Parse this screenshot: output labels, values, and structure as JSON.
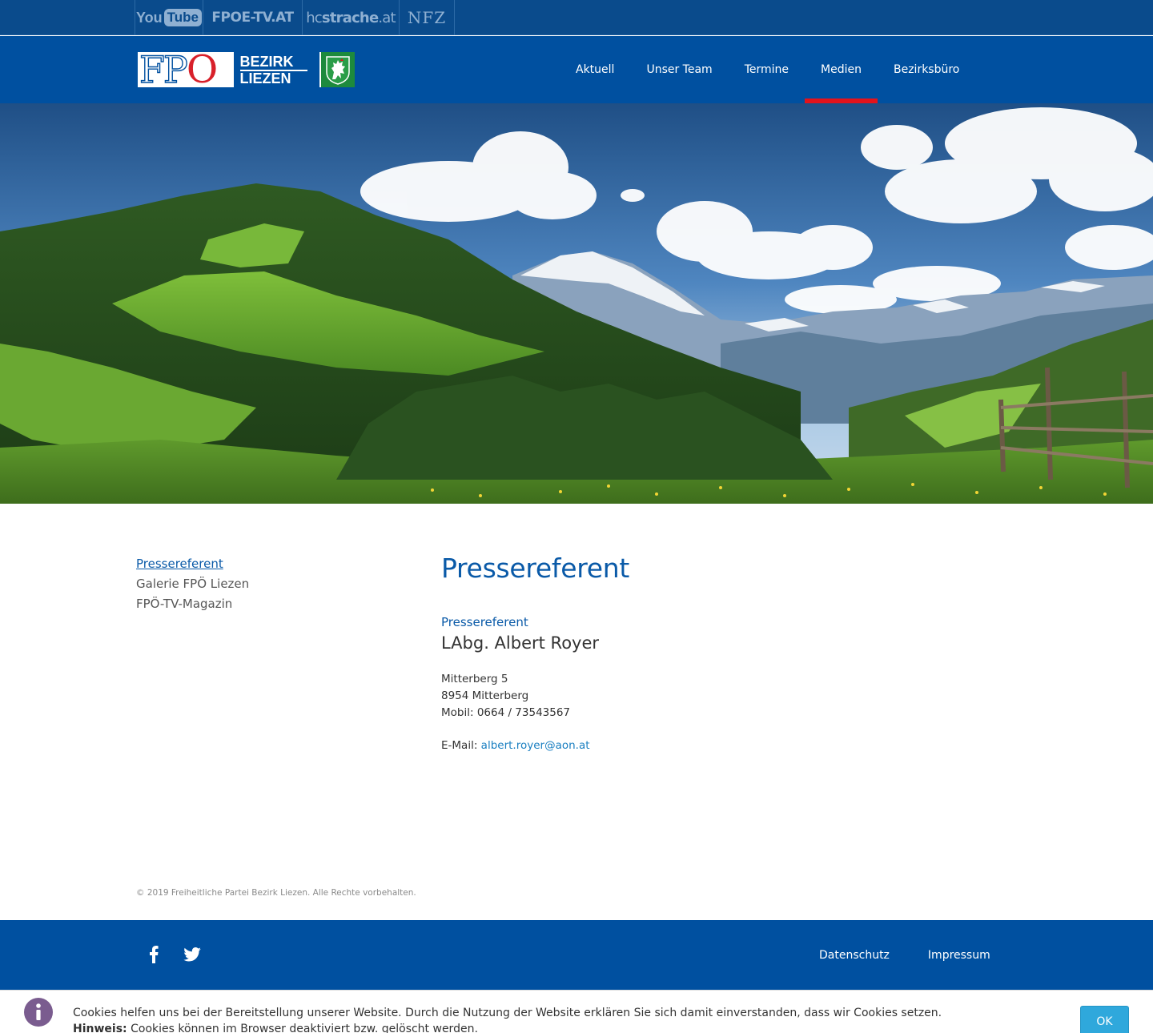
{
  "partners": {
    "youtube": {
      "you": "You",
      "tube": "Tube"
    },
    "fpoe_tv": "FPOE-TV.AT",
    "hcstrache": {
      "prefix": "hc",
      "bold": "strache",
      "suffix": ".at"
    },
    "nfz": "NFZ"
  },
  "logo": {
    "fpo_letters": "FP",
    "fpo_o": "O",
    "line1": "BEZIRK",
    "line2": "LIEZEN"
  },
  "nav": {
    "items": [
      {
        "label": "Aktuell",
        "active": false
      },
      {
        "label": "Unser Team",
        "active": false
      },
      {
        "label": "Termine",
        "active": false
      },
      {
        "label": "Medien",
        "active": true
      },
      {
        "label": "Bezirksbüro",
        "active": false
      }
    ]
  },
  "subnav": {
    "items": [
      {
        "label": "Pressereferent",
        "current": true
      },
      {
        "label": "Galerie FPÖ Liezen",
        "current": false
      },
      {
        "label": "FPÖ-TV-Magazin",
        "current": false
      }
    ]
  },
  "main": {
    "title": "Pressereferent",
    "role": "Pressereferent",
    "person": "LAbg. Albert Royer",
    "address_lines": [
      "Mitterberg 5",
      "8954 Mitterberg",
      "Mobil: 0664 / 73543567"
    ],
    "email_label": "E-Mail:",
    "email": "albert.royer@aon.at"
  },
  "copyright": "© 2019 Freiheitliche Partei Bezirk Liezen. Alle Rechte vorbehalten.",
  "footer": {
    "social": [
      "facebook-icon",
      "twitter-icon"
    ],
    "links": [
      "Datenschutz",
      "Impressum"
    ]
  },
  "cookie": {
    "text": "Cookies helfen uns bei der Bereitstellung unserer Website. Durch die Nutzung der Website erklären Sie sich damit einverstanden, dass wir Cookies setzen.",
    "hint_label": "Hinweis:",
    "hint_text": "Cookies können im Browser deaktiviert bzw. gelöscht werden.",
    "ok_label": "OK"
  },
  "colors": {
    "brand_blue": "#0050a0",
    "top_bar": "#0a4b8c",
    "active_underline": "#e3131b",
    "heading_blue": "#0a5aa8",
    "link_blue": "#1a7fc1",
    "cookie_button": "#2fa8dc"
  }
}
